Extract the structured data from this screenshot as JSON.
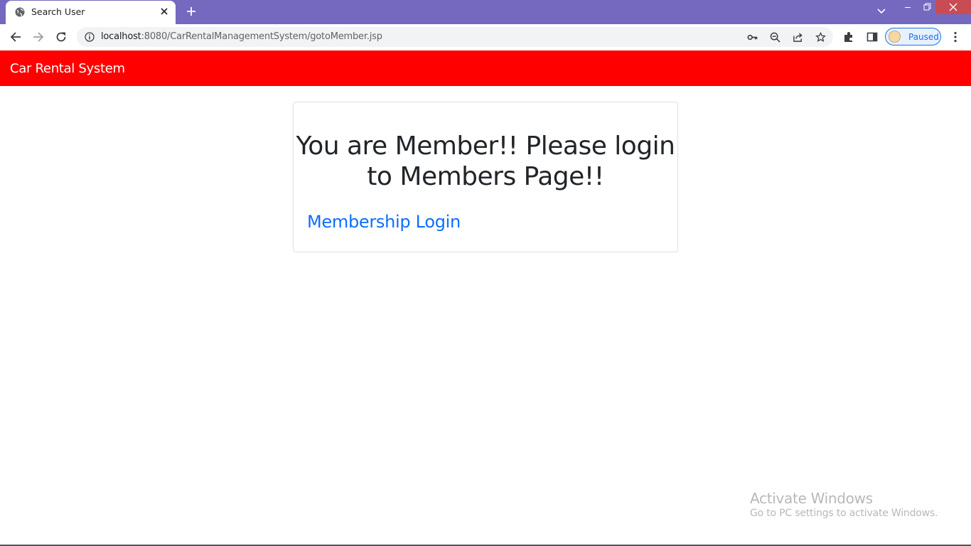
{
  "browser": {
    "tab": {
      "title": "Search User",
      "favicon": "globe-icon"
    },
    "address": {
      "host": "localhost",
      "rest": ":8080/CarRentalManagementSystem/gotoMember.jsp"
    },
    "profile_status": "Paused",
    "colors": {
      "tabstrip": "#7469be",
      "close_button": "#c94c55"
    }
  },
  "page": {
    "brand": "Car Rental System",
    "message": "You are Member!! Please login to Members Page!!",
    "link_label": "Membership Login",
    "colors": {
      "navbar": "#ff0000",
      "link": "#0d6efd"
    }
  },
  "watermark": {
    "title": "Activate Windows",
    "subtitle": "Go to PC settings to activate Windows."
  }
}
